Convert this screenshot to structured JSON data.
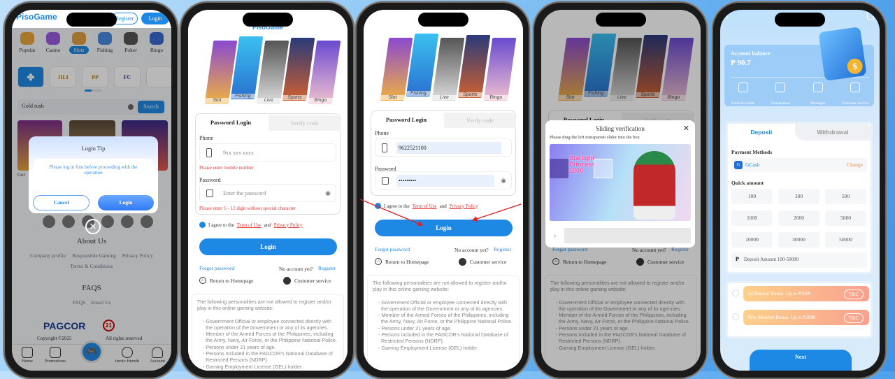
{
  "colors": {
    "brand_blue": "#1e88e5",
    "error_red": "#e53935",
    "change_orange": "#f08a3c",
    "arrow_red": "#e02020"
  },
  "home_screen": {
    "logo_text": "PisoGame",
    "register_label": "Register",
    "login_label": "Login",
    "categories": [
      {
        "label": "Popular",
        "icon": "hot-icon"
      },
      {
        "label": "Casino",
        "icon": "chips-icon"
      },
      {
        "label": "Slots",
        "icon": "slot-777-icon"
      },
      {
        "label": "Fishing",
        "icon": "fish-icon"
      },
      {
        "label": "Poker",
        "icon": "cards-icon"
      },
      {
        "label": "Bingo",
        "icon": "bingo-icon"
      }
    ],
    "active_category": "Slots",
    "providers": [
      "grid",
      "JILI",
      "PP",
      "FC",
      ""
    ],
    "search_value": "Gold rush",
    "search_button": "Search",
    "game_label_partial": "Gol",
    "modal": {
      "title": "Login Tip",
      "message": "Please log in first before proceeding with the operation",
      "cancel": "Cancel",
      "login": "Login"
    },
    "about_title": "About Us",
    "about_links": [
      "Company profile",
      "Responsible Gaming",
      "Privacy Policy",
      "Terms & Conditions"
    ],
    "faqs_title": "FAQS",
    "faqs_links": [
      "FAQS",
      "Email Us"
    ],
    "pagcor": "PAGCOR",
    "copyright_left": "Copyright ©2025",
    "copyright_right": "All rights reserved",
    "nav": [
      "Home",
      "Promotions",
      "Invite friends",
      "Account"
    ]
  },
  "login": {
    "logo_text": "PisoGame",
    "banner": [
      "Slot",
      "Fishing",
      "Live",
      "Sports",
      "Bingo"
    ],
    "tab_password": "Password Login",
    "tab_verify": "Verify code",
    "phone_label": "Phone",
    "phone_placeholder": "9xx xxx xxxx",
    "password_label": "Password",
    "password_placeholder": "Enter the password",
    "phone_error": "Please enter mobile number",
    "password_error": "Please enter 6 - 12 digit without special character",
    "agree_prefix": "I agree to the",
    "terms": "Term of Use",
    "and": "and",
    "privacy": "Privacy Policy",
    "login_button": "Login",
    "forgot": "Forgot password",
    "no_account": "No account yet?",
    "register": "Register",
    "return_home": "Return to Homepage",
    "customer_service": "Customer service",
    "notice_intro": "The following personalities are not allowed to register and/or play in this online gaming website:",
    "notice_items": [
      "- Government Official or employee connected directly with the operation of the Government or any of its agencies.",
      "- Member of the Armed Forces of the Philippines, including the Army, Navy, Air Force, or the Philippine National Police.",
      "- Persons under 21 years of age.",
      "- Persons included in the PAGCOR's National Database of Restricted Persons (NDRP).",
      "- Gaming Employment License (GEL) holder."
    ]
  },
  "login_states": [
    {
      "phone_value": "",
      "password_masked": "",
      "show_errors": true,
      "agreed": true
    },
    {
      "phone_value": "9622521100",
      "password_masked": "•••••••••",
      "show_errors": false,
      "agreed": true
    },
    {
      "phone_value": "9622521100",
      "password_masked": "•••••••••",
      "show_errors": false,
      "agreed": true
    }
  ],
  "slider_modal": {
    "title": "Sliding verification",
    "instruction": "Please drag the left transparent slider into the box",
    "image_title": "Starlight Princess 1000"
  },
  "deposit_screen": {
    "title": "Deposit",
    "balance_label": "Account balance",
    "balance_value": "₱ 90.7",
    "shortcuts": [
      {
        "label": "Fund Accounts",
        "icon": "fund-accounts-icon"
      },
      {
        "label": "Transactions",
        "icon": "transactions-icon"
      },
      {
        "label": "Messages",
        "icon": "messages-icon"
      },
      {
        "label": "Customer Service",
        "icon": "headset-icon"
      }
    ],
    "tab_deposit": "Deposit",
    "tab_withdrawal": "Withdrawal",
    "payment_methods_label": "Payment Methods",
    "method": "GCash",
    "change": "Change",
    "quick_amount_label": "Quick amount",
    "amounts": [
      "100",
      "300",
      "500",
      "1000",
      "2000",
      "5000",
      "10000",
      "30000",
      "50000"
    ],
    "amount_placeholder": "Deposit Amount 100-50000",
    "currency_symbol": "₱",
    "bonuses": [
      {
        "text": "1st Deposit Bonus: Up to ₱3000",
        "tc": "T&C"
      },
      {
        "text": "New Member Bonus: Up to ₱2888",
        "tc": "T&C"
      }
    ],
    "next": "Next"
  }
}
